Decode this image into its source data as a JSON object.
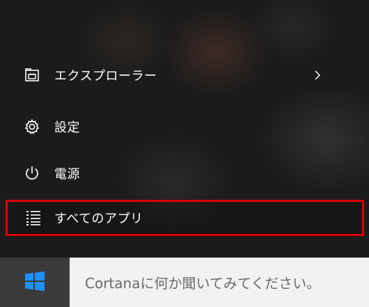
{
  "start_menu": {
    "items": [
      {
        "label": "エクスプローラー",
        "icon": "file-explorer-icon",
        "has_submenu": true,
        "submenu_icon": "chevron-right-icon"
      },
      {
        "label": "設定",
        "icon": "gear-icon"
      },
      {
        "label": "電源",
        "icon": "power-icon"
      },
      {
        "label": "すべてのアプリ",
        "icon": "all-apps-list-icon",
        "highlighted": true,
        "highlight_color": "#e00000"
      }
    ]
  },
  "taskbar": {
    "start_button_icon": "windows-logo-icon",
    "start_button_color": "#1e90ff",
    "search_placeholder": "Cortanaに何か聞いてみてください。"
  }
}
